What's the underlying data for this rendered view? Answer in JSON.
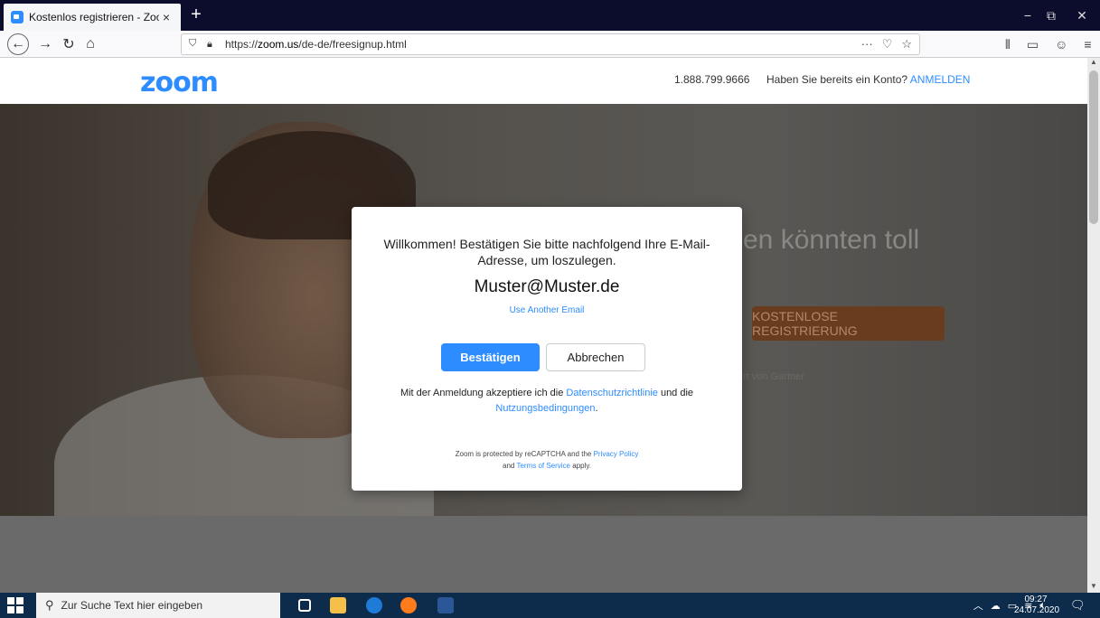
{
  "browser": {
    "tab_title": "Kostenlos registrieren - Zoom",
    "tab_close": "×",
    "new_tab": "+",
    "url_prefix": "https://",
    "url_domain": "zoom.us",
    "url_path": "/de-de/freesignup.html",
    "url_more": "···",
    "window_controls": [
      "−",
      "⧉",
      "✕"
    ]
  },
  "page": {
    "logo": "zoom",
    "phone": "1.888.799.9666",
    "account_question": "Haben Sie bereits ein Konto?",
    "signin_link": "ANMELDEN",
    "hero_title": "en könnten toll",
    "hero_cta": "KOSTENLOSE REGISTRIERUNG",
    "hero_gartner": "rt von Gartner"
  },
  "modal": {
    "message": "Willkommen! Bestätigen Sie bitte nachfolgend Ihre E-Mail-Adresse, um loszulegen.",
    "email": "Muster@Muster.de",
    "use_another": "Use Another Email",
    "confirm_label": "Bestätigen",
    "cancel_label": "Abbrechen",
    "terms_prefix": "Mit der Anmeldung akzeptiere ich die ",
    "terms_privacy": "Datenschutzrichtlinie",
    "terms_mid": " und die ",
    "terms_tos": "Nutzungsbedingungen",
    "terms_suffix": ".",
    "recaptcha_prefix": "Zoom is protected by reCAPTCHA and the ",
    "recaptcha_privacy": "Privacy Policy",
    "recaptcha_and": "and ",
    "recaptcha_tos": "Terms of Service",
    "recaptcha_suffix": " apply."
  },
  "taskbar": {
    "search_placeholder": "Zur Suche Text hier eingeben",
    "time": "09:27",
    "date": "24.07.2020"
  },
  "colors": {
    "accent": "#2d8cff",
    "cta": "#6a3c1e",
    "taskbar": "#0d2b4a"
  }
}
